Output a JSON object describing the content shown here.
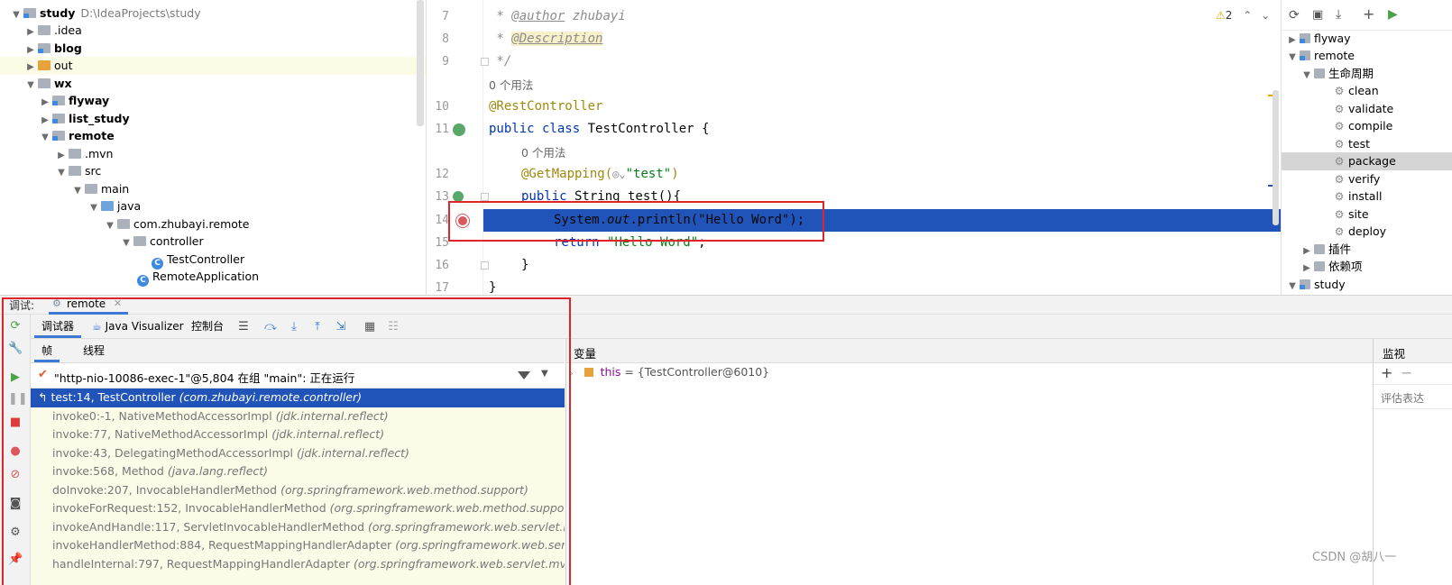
{
  "project_tree": {
    "items": [
      {
        "label": "study",
        "path": "D:\\IdeaProjects\\study"
      },
      {
        "label": ".idea"
      },
      {
        "label": "blog"
      },
      {
        "label": "out"
      },
      {
        "label": "wx"
      },
      {
        "label": "flyway"
      },
      {
        "label": "list_study"
      },
      {
        "label": "remote"
      },
      {
        "label": ".mvn"
      },
      {
        "label": "src"
      },
      {
        "label": "main"
      },
      {
        "label": "java"
      },
      {
        "label": "com.zhubayi.remote"
      },
      {
        "label": "controller"
      },
      {
        "label": "TestController"
      },
      {
        "label": "RemoteApplication"
      }
    ]
  },
  "editor": {
    "warning_count": "2",
    "line_numbers": [
      "7",
      "8",
      "9",
      "10",
      "11",
      "12",
      "13",
      "14",
      "15",
      "16",
      "17"
    ],
    "lines": {
      "l7a": " * ",
      "l7b": "@author",
      "l7c": " zhubayi",
      "l8a": " * ",
      "l8b": "@Description",
      "l9": " */",
      "usage1": "0 个用法",
      "l10": "@RestController",
      "l11a": "public class",
      "l11b": " TestController {",
      "usage2": "0 个用法",
      "l12a": "@GetMapping(",
      "l12b": "\"test\"",
      "l12c": ")",
      "l13a": "public",
      "l13b": " String test(){",
      "l14a": "System.",
      "l14b": "out",
      "l14c": ".println(\"Hello Word\");",
      "l15a": "return ",
      "l15b": "\"Hello Word\"",
      "l15c": ";",
      "l16": "}",
      "l17": "}"
    }
  },
  "maven": {
    "items": [
      {
        "label": "flyway"
      },
      {
        "label": "remote"
      },
      {
        "label": "生命周期"
      },
      {
        "label": "clean"
      },
      {
        "label": "validate"
      },
      {
        "label": "compile"
      },
      {
        "label": "test"
      },
      {
        "label": "package"
      },
      {
        "label": "verify"
      },
      {
        "label": "install"
      },
      {
        "label": "site"
      },
      {
        "label": "deploy"
      },
      {
        "label": "插件"
      },
      {
        "label": "依赖项"
      },
      {
        "label": "study"
      }
    ]
  },
  "debug": {
    "panel_label": "调试:",
    "session_tab": "remote",
    "toolbar": {
      "debugger": "调试器",
      "java_visualizer": "Java Visualizer",
      "console": "控制台"
    },
    "frames_tab": "帧",
    "threads_tab": "线程",
    "thread_status": "\"http-nio-10086-exec-1\"@5,804 在组 \"main\": 正在运行",
    "frames": [
      {
        "method": "test:14, TestController",
        "pkg": "(com.zhubayi.remote.controller)"
      },
      {
        "method": "invoke0:-1, NativeMethodAccessorImpl",
        "pkg": "(jdk.internal.reflect)"
      },
      {
        "method": "invoke:77, NativeMethodAccessorImpl",
        "pkg": "(jdk.internal.reflect)"
      },
      {
        "method": "invoke:43, DelegatingMethodAccessorImpl",
        "pkg": "(jdk.internal.reflect)"
      },
      {
        "method": "invoke:568, Method",
        "pkg": "(java.lang.reflect)"
      },
      {
        "method": "doInvoke:207, InvocableHandlerMethod",
        "pkg": "(org.springframework.web.method.support)"
      },
      {
        "method": "invokeForRequest:152, InvocableHandlerMethod",
        "pkg": "(org.springframework.web.method.support)"
      },
      {
        "method": "invokeAndHandle:117, ServletInvocableHandlerMethod",
        "pkg": "(org.springframework.web.servlet.mvc.meth"
      },
      {
        "method": "invokeHandlerMethod:884, RequestMappingHandlerAdapter",
        "pkg": "(org.springframework.web.servlet.mvc"
      },
      {
        "method": "handleInternal:797, RequestMappingHandlerAdapter",
        "pkg": "(org.springframework.web.servlet.mvc.method"
      }
    ],
    "variables_label": "变量",
    "variable": {
      "name": "this",
      "value": " = {TestController@6010}"
    },
    "watch_label": "监视",
    "watch_placeholder": "评估表达"
  },
  "watermark": "CSDN @胡八一",
  "colors": {
    "selection": "#2154b9",
    "breakpoint": "#db5860",
    "annotation_box": "#e0242a"
  }
}
